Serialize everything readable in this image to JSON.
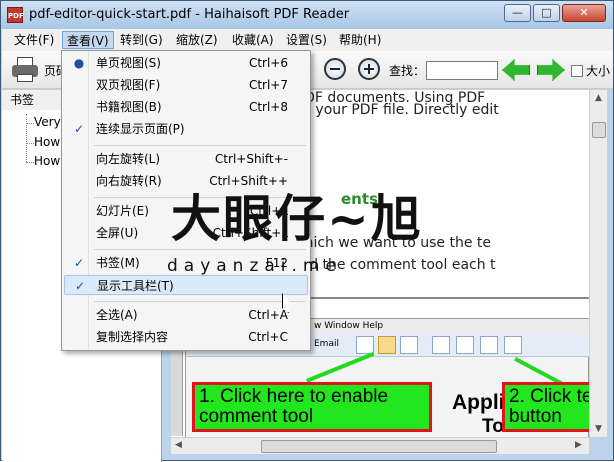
{
  "window": {
    "title": "pdf-editor-quick-start.pdf - Haihaisoft PDF Reader",
    "app_icon_text": "PDF",
    "minimize_glyph": "—",
    "maximize_glyph": "□",
    "close_glyph": "✕"
  },
  "menubar": {
    "items": [
      {
        "label": "文件(F)"
      },
      {
        "label": "查看(V)"
      },
      {
        "label": "转到(G)"
      },
      {
        "label": "缩放(Z)"
      },
      {
        "label": "收藏(A)"
      },
      {
        "label": "设置(S)"
      },
      {
        "label": "帮助(H)"
      }
    ]
  },
  "toolbar": {
    "page_label": "页码",
    "find_label": "查找：",
    "find_value": "",
    "checkbox_label": "大小",
    "icons": [
      "printer-icon",
      "zoom-out-icon",
      "zoom-in-icon",
      "previous-arrow-icon",
      "next-arrow-icon"
    ]
  },
  "sidebar": {
    "header": "书签",
    "items": [
      {
        "label": "Very"
      },
      {
        "label": "How"
      },
      {
        "label": "How"
      }
    ]
  },
  "view_menu": {
    "items": [
      {
        "label": "单页视图(S)",
        "shortcut": "Ctrl+6",
        "mark": "●"
      },
      {
        "label": "双页视图(F)",
        "shortcut": "Ctrl+7",
        "mark": ""
      },
      {
        "label": "书籍视图(B)",
        "shortcut": "Ctrl+8",
        "mark": ""
      },
      {
        "label": "连续显示页面(P)",
        "shortcut": "",
        "mark": "✓"
      },
      {
        "label": "向左旋转(L)",
        "shortcut": "Ctrl+Shift+-",
        "mark": ""
      },
      {
        "label": "向右旋转(R)",
        "shortcut": "Ctrl+Shift++",
        "mark": ""
      },
      {
        "label": "幻灯片(E)",
        "shortcut": "Ctrl+L",
        "mark": ""
      },
      {
        "label": "全屏(U)",
        "shortcut": "Ctrl+Shift+L",
        "mark": ""
      },
      {
        "label": "书签(M)",
        "shortcut": "F12",
        "mark": "✓"
      },
      {
        "label": "显示工具栏(T)",
        "shortcut": "",
        "mark": "✓"
      },
      {
        "label": "全选(A)",
        "shortcut": "Ctrl+A",
        "mark": ""
      },
      {
        "label": "复制选择内容",
        "shortcut": "Ctrl+C",
        "mark": ""
      }
    ]
  },
  "document": {
    "line1": "nd work with PDF documents. Using PDF",
    "line2": "nts, contents to your PDF file. Directly edit",
    "heading": "ents",
    "line3": "r example in which we want to use the te",
    "line4": "ou have enabled the comment tool each t",
    "screenshot": {
      "menu_text": "w  Window  Help",
      "email_label": "Email",
      "callout1": "1. Click here to enable comment tool",
      "callout2": "2. Click te button",
      "heading1": "Applic",
      "heading2": "To"
    }
  },
  "watermark": {
    "chinese": "大眼仔~旭",
    "domain": "dayanzai.me"
  },
  "colors": {
    "callout_fill": "#22e61e",
    "callout_border": "#e0141b",
    "menu_highlight": "#dce9f8",
    "check_mark": "#1c4f9c"
  }
}
